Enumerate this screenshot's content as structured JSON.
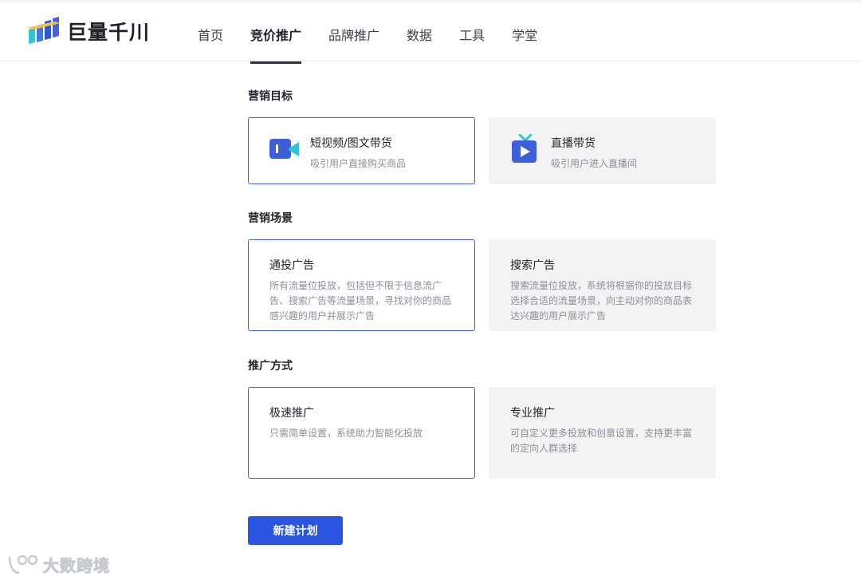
{
  "app": {
    "logo_text": "巨量千川",
    "brand_color": "#2b54e0"
  },
  "nav": {
    "items": [
      {
        "label": "首页",
        "active": false
      },
      {
        "label": "竞价推广",
        "active": true
      },
      {
        "label": "品牌推广",
        "active": false
      },
      {
        "label": "数据",
        "active": false
      },
      {
        "label": "工具",
        "active": false
      },
      {
        "label": "学堂",
        "active": false
      }
    ]
  },
  "sections": {
    "goal": {
      "title": "营销目标",
      "options": [
        {
          "title": "短视频/图文带货",
          "desc": "吸引用户直接购买商品",
          "icon": "video-camera-icon",
          "selected": true
        },
        {
          "title": "直播带货",
          "desc": "吸引用户进入直播间",
          "icon": "live-tv-icon",
          "selected": false
        }
      ]
    },
    "scene": {
      "title": "营销场景",
      "options": [
        {
          "title": "通投广告",
          "desc": "所有流量位投放，包括但不限于信息流广告、搜索广告等流量场景，寻找对你的商品感兴趣的用户并展示广告",
          "selected": true
        },
        {
          "title": "搜索广告",
          "desc": "搜索流量位投放，系统将根据你的投放目标选择合适的流量场景，向主动对你的商品表达兴趣的用户展示广告",
          "selected": false
        }
      ]
    },
    "method": {
      "title": "推广方式",
      "options": [
        {
          "title": "极速推广",
          "desc": "只需简单设置，系统助力智能化投放",
          "selected": true
        },
        {
          "title": "专业推广",
          "desc": "可自定义更多投放和创意设置，支持更丰富的定向人群选择",
          "selected": false
        }
      ]
    }
  },
  "actions": {
    "create_plan_label": "新建计划"
  },
  "watermark": {
    "text": "大数跨境"
  }
}
